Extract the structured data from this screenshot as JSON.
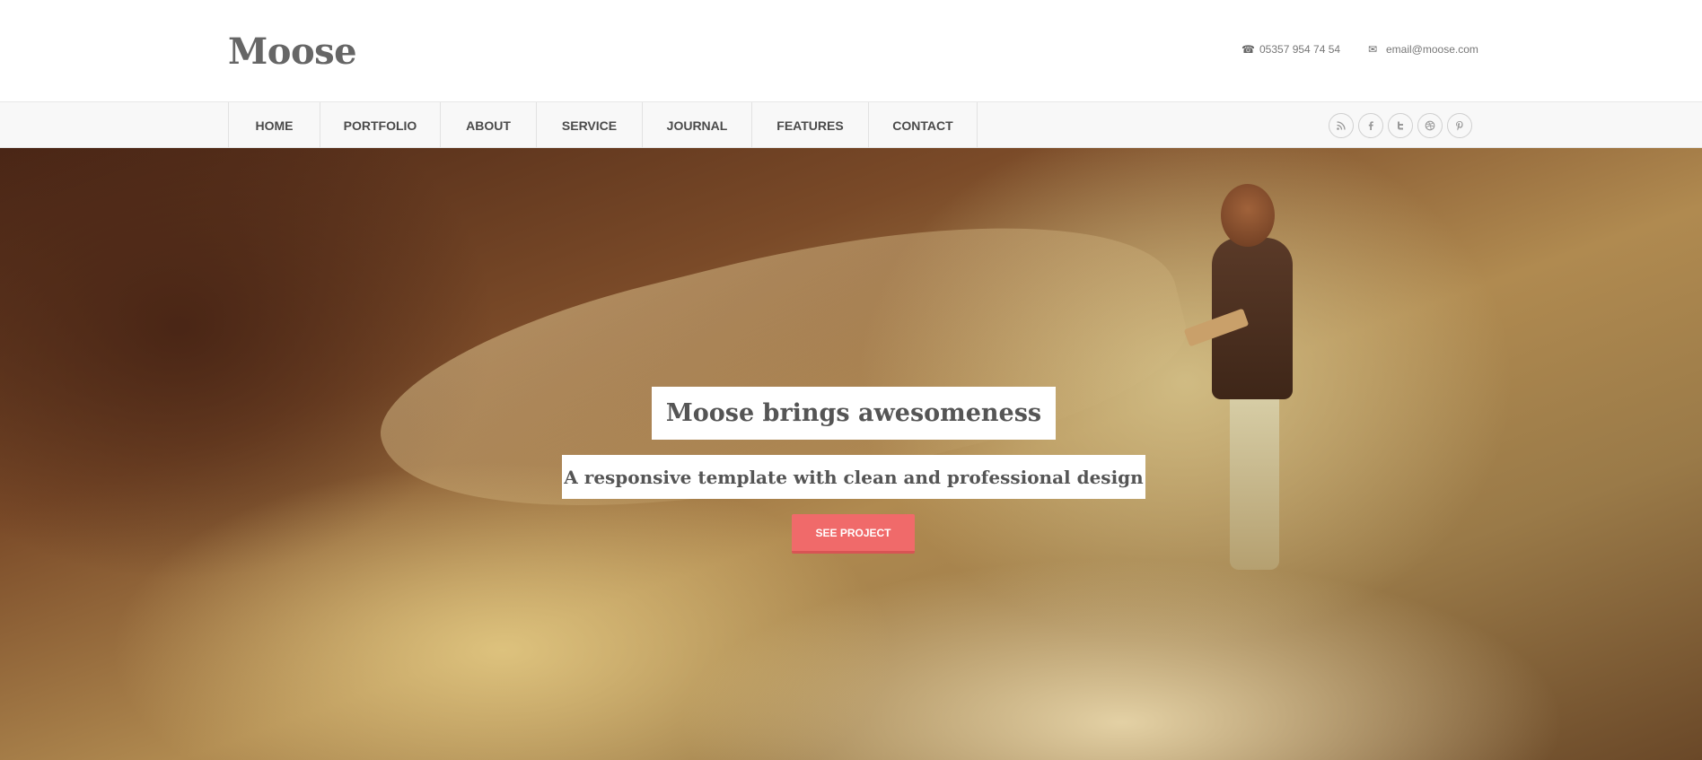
{
  "header": {
    "logo": "Moose",
    "phone": "05357 954 74 54",
    "email": "email@moose.com"
  },
  "nav": {
    "items": [
      {
        "label": "HOME"
      },
      {
        "label": "PORTFOLIO"
      },
      {
        "label": "ABOUT"
      },
      {
        "label": "SERVICE"
      },
      {
        "label": "JOURNAL"
      },
      {
        "label": "FEATURES"
      },
      {
        "label": "CONTACT"
      }
    ],
    "social": [
      "rss-icon",
      "facebook-icon",
      "twitter-icon",
      "dribbble-icon",
      "pinterest-icon"
    ]
  },
  "hero": {
    "title": "Moose brings awesomeness",
    "subtitle": "A responsive template with clean and professional design",
    "button_label": "SEE PROJECT"
  },
  "colors": {
    "accent": "#f06a6a",
    "nav_background": "#f8f8f8",
    "text": "#555555"
  }
}
